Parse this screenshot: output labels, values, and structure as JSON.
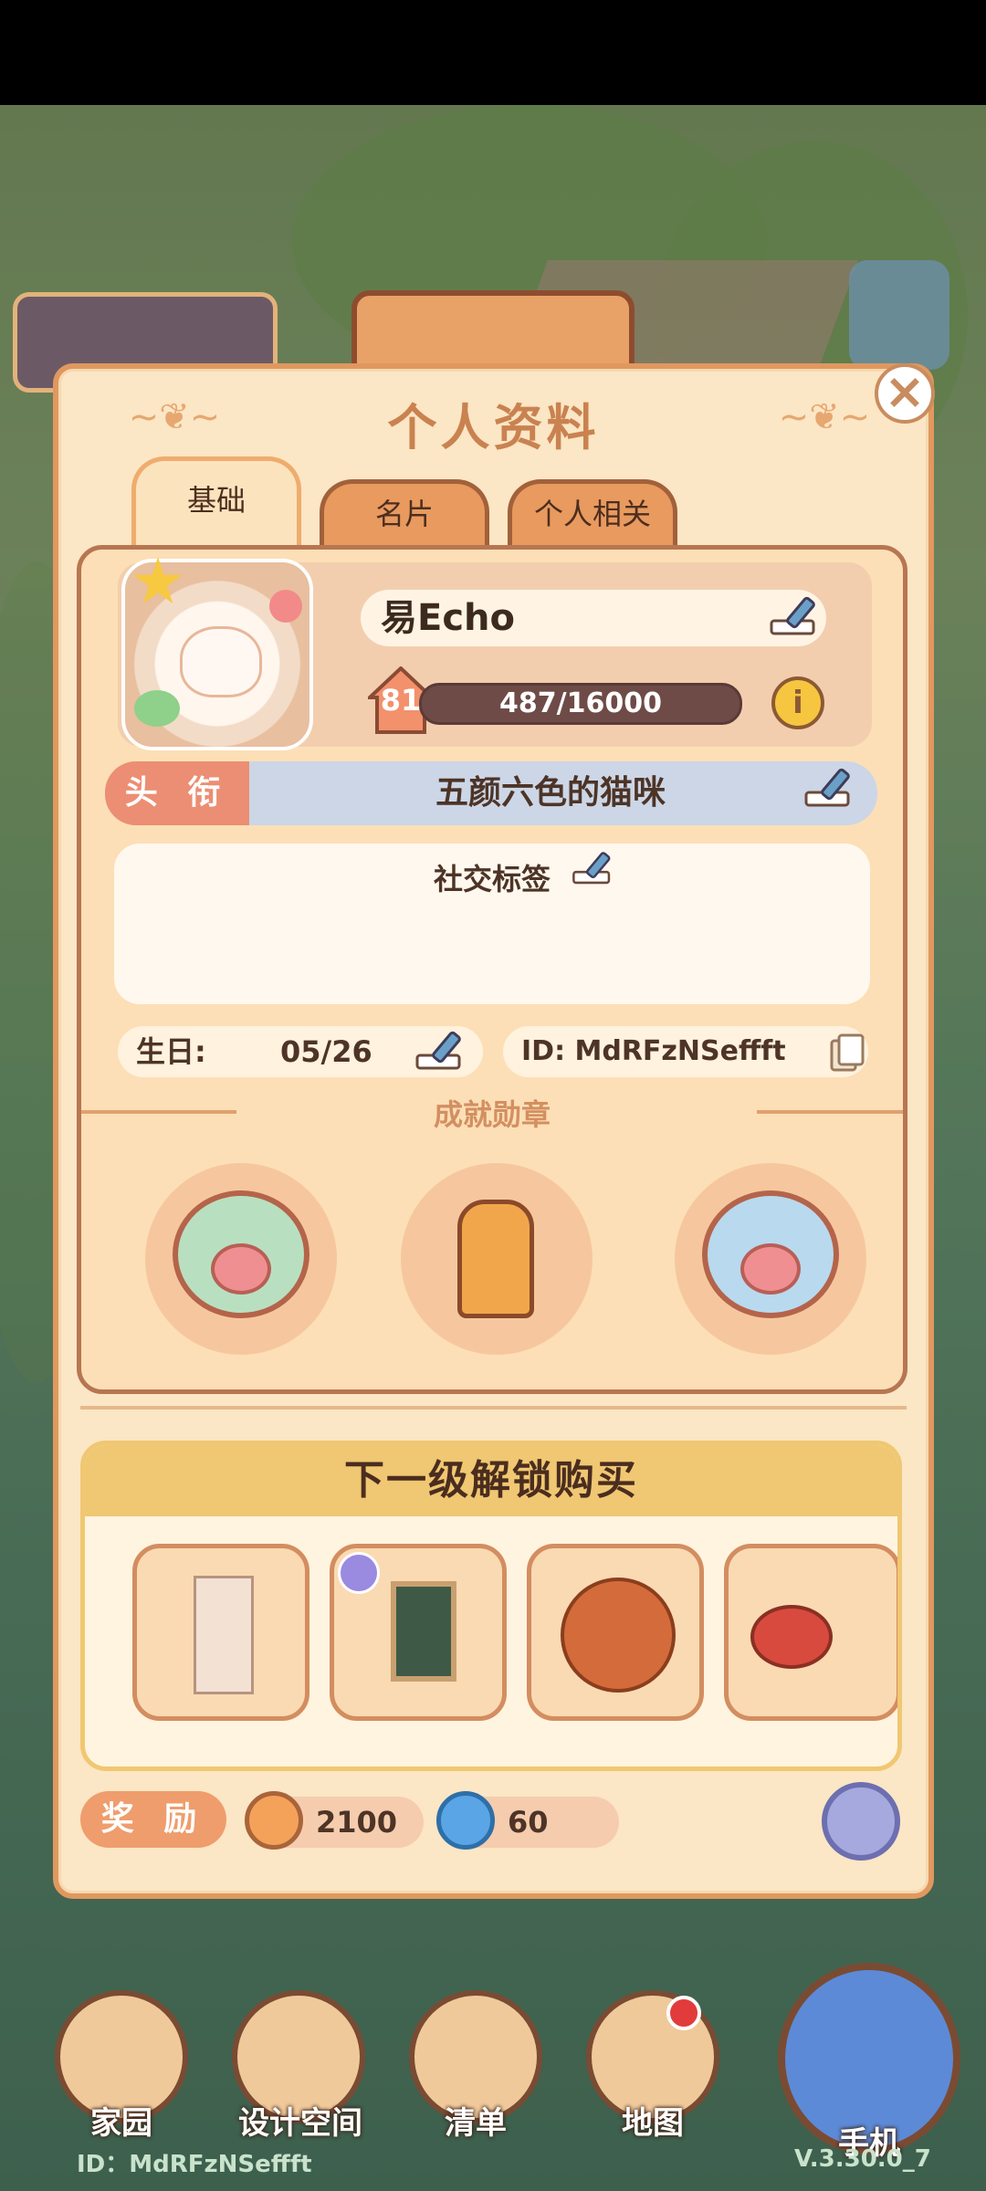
{
  "panel": {
    "title": "个人资料",
    "tabs": [
      {
        "label": "基础",
        "active": true
      },
      {
        "label": "名片",
        "active": false
      },
      {
        "label": "个人相关",
        "active": false
      }
    ]
  },
  "profile": {
    "name": "易Echo",
    "level": "81",
    "xp": "487/16000",
    "title_label": "头 衔",
    "title_value": "五颜六色的猫咪",
    "social_tags_label": "社交标签",
    "birthday_label": "生日:",
    "birthday_value": "05/26",
    "id_text": "ID: MdRFzNSeffft"
  },
  "achievements": {
    "title": "成就勋章",
    "badges": [
      "green-paw-badge",
      "orange-outfit-badge",
      "blue-paw-badge"
    ]
  },
  "unlock": {
    "title": "下一级解锁购买",
    "items": [
      "bookshelf-item",
      "easel-board-item",
      "basketball-item",
      "ping-pong-paddle-item"
    ]
  },
  "rewards": {
    "label": "奖 励",
    "coins": "2100",
    "gems": "60"
  },
  "nav": {
    "home": "家园",
    "design": "设计空间",
    "list": "清单",
    "map": "地图",
    "phone": "手机"
  },
  "footer": {
    "id": "ID：MdRFzNSeffft",
    "version": "V.3.30.0_7"
  },
  "colors": {
    "panel_bg": "#fbe6c5",
    "accent": "#e0985f",
    "title_label": "#ec8e73"
  }
}
